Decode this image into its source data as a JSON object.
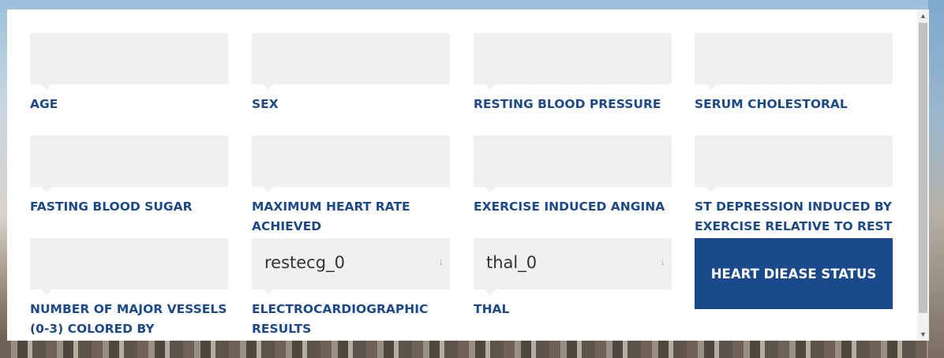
{
  "form": {
    "fields": [
      {
        "label": "AGE",
        "value": ""
      },
      {
        "label": "SEX",
        "value": ""
      },
      {
        "label": "RESTING BLOOD PRESSURE",
        "value": ""
      },
      {
        "label": "SERUM CHOLESTORAL",
        "value": ""
      },
      {
        "label": "FASTING BLOOD SUGAR",
        "value": ""
      },
      {
        "label": "MAXIMUM HEART RATE ACHIEVED",
        "value": ""
      },
      {
        "label": "EXERCISE INDUCED ANGINA",
        "value": ""
      },
      {
        "label": "ST DEPRESSION INDUCED BY EXERCISE RELATIVE TO REST",
        "value": ""
      },
      {
        "label": "NUMBER OF MAJOR VESSELS (0-3) COLORED BY",
        "value": ""
      },
      {
        "label": "ELECTROCARDIOGRAPHIC RESULTS",
        "value": "restecg_0"
      },
      {
        "label": "THAL",
        "value": "thal_0"
      }
    ],
    "submit_label": "HEART DIEASE STATUS"
  },
  "icons": {
    "select_arrow": "arrow-down-icon",
    "scroll_up": "chevron-up-icon",
    "scroll_down": "chevron-down-icon"
  },
  "colors": {
    "label": "#1d4a86",
    "button": "#1a4a8b",
    "field_bg": "#f0f0f0"
  }
}
